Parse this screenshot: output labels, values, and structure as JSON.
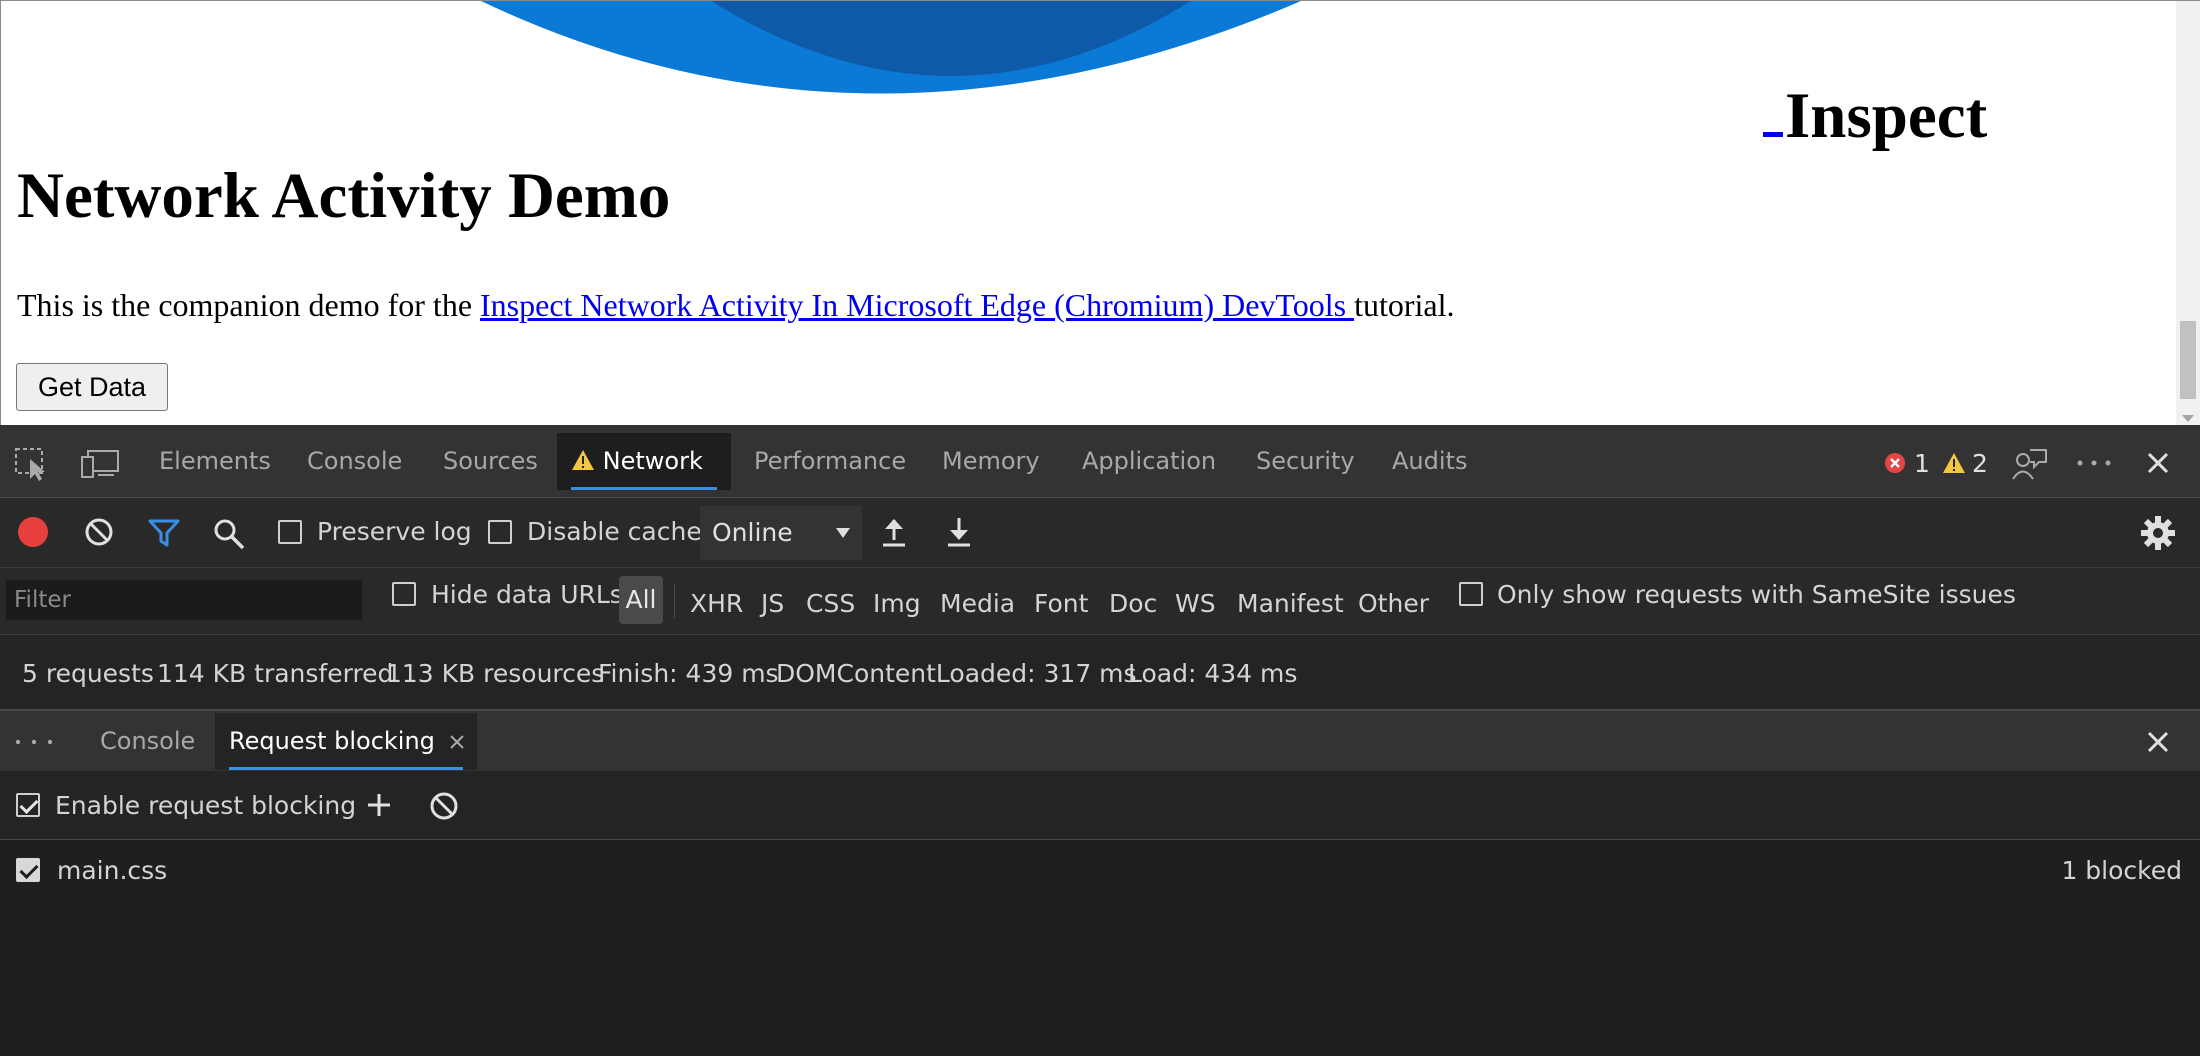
{
  "page": {
    "inspect_heading": "Inspect",
    "title": "Network Activity Demo",
    "intro_prefix": "This is the companion demo for the ",
    "intro_link": "Inspect Network Activity In Microsoft Edge (Chromium) DevTools ",
    "intro_suffix": "tutorial.",
    "get_data_button": "Get Data"
  },
  "devtools": {
    "tabs": [
      "Elements",
      "Console",
      "Sources",
      "Network",
      "Performance",
      "Memory",
      "Application",
      "Security",
      "Audits"
    ],
    "active_tab": "Network",
    "error_count": "1",
    "warning_count": "2",
    "toolbar": {
      "preserve_log": "Preserve log",
      "disable_cache": "Disable cache",
      "throttling": "Online"
    },
    "filter": {
      "placeholder": "Filter",
      "hide_data_urls": "Hide data URLs",
      "types": [
        "All",
        "XHR",
        "JS",
        "CSS",
        "Img",
        "Media",
        "Font",
        "Doc",
        "WS",
        "Manifest",
        "Other"
      ],
      "samesite": "Only show requests with SameSite issues"
    },
    "summary": {
      "requests": "5 requests",
      "transferred": "114 KB transferred",
      "resources": "113 KB resources",
      "finish": "Finish: 439 ms",
      "dcl": "DOMContentLoaded: 317 ms",
      "load": "Load: 434 ms"
    },
    "drawer": {
      "tabs": [
        "Console",
        "Request blocking"
      ],
      "active_tab": "Request blocking",
      "enable_blocking": "Enable request blocking",
      "patterns": [
        {
          "pattern": "main.css",
          "status": "1 blocked",
          "enabled": true
        }
      ]
    }
  }
}
